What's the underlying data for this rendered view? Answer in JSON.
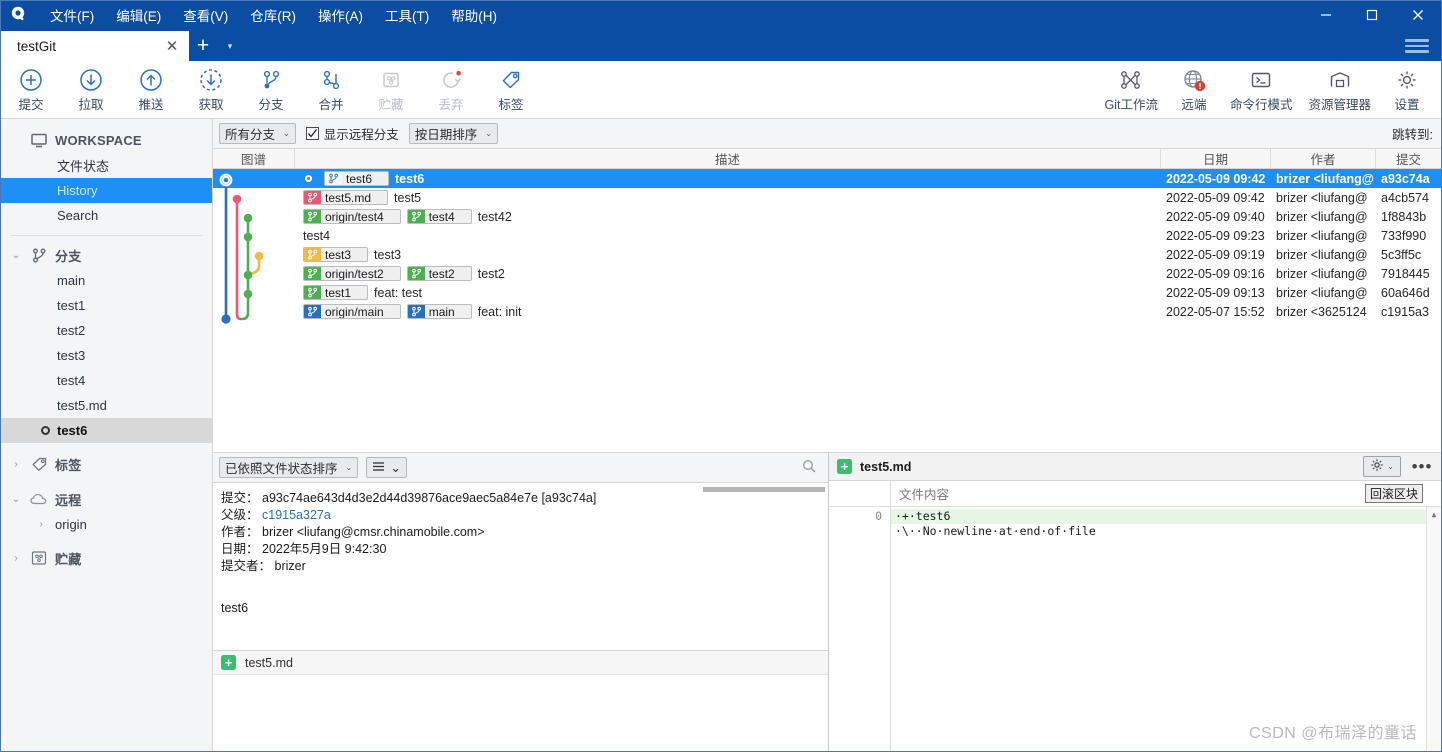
{
  "window": {
    "app_icon": "sourcetree-logo-icon",
    "minimize": "−",
    "maximize": "□",
    "close": "✕",
    "menu": [
      {
        "label": "文件(F)",
        "name": "menu-file"
      },
      {
        "label": "编辑(E)",
        "name": "menu-edit"
      },
      {
        "label": "查看(V)",
        "name": "menu-view"
      },
      {
        "label": "仓库(R)",
        "name": "menu-repository"
      },
      {
        "label": "操作(A)",
        "name": "menu-actions"
      },
      {
        "label": "工具(T)",
        "name": "menu-tools"
      },
      {
        "label": "帮助(H)",
        "name": "menu-help"
      }
    ]
  },
  "tabs": {
    "active": "testGit",
    "close_label": "✕",
    "add_label": "+",
    "caret_label": "▾"
  },
  "toolbar": {
    "left": [
      {
        "label": "提交",
        "icon": "commit-plus-icon",
        "disabled": false
      },
      {
        "label": "拉取",
        "icon": "pull-down-arrow-icon",
        "disabled": false
      },
      {
        "label": "推送",
        "icon": "push-up-arrow-icon",
        "disabled": false
      },
      {
        "label": "获取",
        "icon": "fetch-dashed-down-icon",
        "disabled": false
      },
      {
        "label": "分支",
        "icon": "branch-icon",
        "disabled": false
      },
      {
        "label": "合并",
        "icon": "merge-icon",
        "disabled": false
      },
      {
        "label": "贮藏",
        "icon": "stash-icon",
        "disabled": true
      },
      {
        "label": "丢弃",
        "icon": "discard-refresh-icon",
        "disabled": true
      },
      {
        "label": "标签",
        "icon": "tag-icon",
        "disabled": false
      }
    ],
    "right": [
      {
        "label": "Git工作流",
        "icon": "gitflow-icon",
        "disabled": false
      },
      {
        "label": "远端",
        "icon": "remote-globe-icon",
        "badge": "!",
        "disabled": false
      },
      {
        "label": "命令行模式",
        "icon": "terminal-icon",
        "disabled": false
      },
      {
        "label": "资源管理器",
        "icon": "explorer-folder-icon",
        "disabled": false
      },
      {
        "label": "设置",
        "icon": "gear-icon",
        "disabled": false
      }
    ]
  },
  "sidebar": {
    "workspace": {
      "label": "WORKSPACE",
      "icon": "monitor-icon"
    },
    "workspace_items": [
      {
        "label": "文件状态",
        "selected": false
      },
      {
        "label": "History",
        "selected": true
      },
      {
        "label": "Search",
        "selected": false
      }
    ],
    "branches": {
      "label": "分支",
      "icon": "branch-icon",
      "expanded": true
    },
    "branch_items": [
      {
        "label": "main",
        "current": false
      },
      {
        "label": "test1",
        "current": false
      },
      {
        "label": "test2",
        "current": false
      },
      {
        "label": "test3",
        "current": false
      },
      {
        "label": "test4",
        "current": false
      },
      {
        "label": "test5.md",
        "current": false
      },
      {
        "label": "test6",
        "current": true
      }
    ],
    "tags": {
      "label": "标签",
      "icon": "tag-icon",
      "expanded": false
    },
    "remotes": {
      "label": "远程",
      "icon": "cloud-icon",
      "expanded": true
    },
    "remote_items": [
      {
        "label": "origin"
      }
    ],
    "stashes": {
      "label": "贮藏",
      "icon": "stash-icon",
      "expanded": false
    }
  },
  "filterbar": {
    "branch_filter": "所有分支",
    "show_remote_branches": "显示远程分支",
    "show_remote_checked": true,
    "sort_order": "按日期排序",
    "jump_to": "跳转到:"
  },
  "commit_table": {
    "columns": [
      "图谱",
      "描述",
      "日期",
      "作者",
      "提交"
    ],
    "rows": [
      {
        "selected": true,
        "head": true,
        "refs": [
          {
            "name": "test6",
            "color": "white"
          }
        ],
        "desc": "test6",
        "date": "2022-05-09 09:42",
        "author": "brizer <liufang@",
        "hash": "a93c74a"
      },
      {
        "selected": false,
        "head": false,
        "refs": [
          {
            "name": "test5.md",
            "color": "pink"
          }
        ],
        "desc": "test5",
        "date": "2022-05-09 09:42",
        "author": "brizer <liufang@",
        "hash": "a4cb574"
      },
      {
        "selected": false,
        "head": false,
        "refs": [
          {
            "name": "origin/test4",
            "color": "green"
          },
          {
            "name": "test4",
            "color": "green"
          }
        ],
        "desc": "test42",
        "date": "2022-05-09 09:40",
        "author": "brizer <liufang@",
        "hash": "1f8843b"
      },
      {
        "selected": false,
        "head": false,
        "refs": [],
        "desc": "test4",
        "date": "2022-05-09 09:23",
        "author": "brizer <liufang@",
        "hash": "733f990"
      },
      {
        "selected": false,
        "head": false,
        "refs": [
          {
            "name": "test3",
            "color": "amber"
          }
        ],
        "desc": "test3",
        "date": "2022-05-09 09:19",
        "author": "brizer <liufang@",
        "hash": "5c3ff5c"
      },
      {
        "selected": false,
        "head": false,
        "refs": [
          {
            "name": "origin/test2",
            "color": "green"
          },
          {
            "name": "test2",
            "color": "green"
          }
        ],
        "desc": "test2",
        "date": "2022-05-09 09:16",
        "author": "brizer <liufang@",
        "hash": "7918445"
      },
      {
        "selected": false,
        "head": false,
        "refs": [
          {
            "name": "test1",
            "color": "green"
          }
        ],
        "desc": "feat: test",
        "date": "2022-05-09 09:13",
        "author": "brizer <liufang@",
        "hash": "60a646d"
      },
      {
        "selected": false,
        "head": false,
        "refs": [
          {
            "name": "origin/main",
            "color": "blue"
          },
          {
            "name": "main",
            "color": "blue"
          }
        ],
        "desc": "feat: init",
        "date": "2022-05-07 15:52",
        "author": "brizer <3625124",
        "hash": "c1915a3"
      }
    ]
  },
  "detail_panel": {
    "sort_combo": "已依照文件状态排序",
    "list_view_icon": "list-view-icon",
    "search_icon": "search-icon",
    "commit_label": "提交：",
    "commit_value": "a93c74ae643d4d3e2d44d39876ace9aec5a84e7e [a93c74a]",
    "parent_label": "父级：",
    "parent_value": "c1915a327a",
    "author_label": "作者：",
    "author_value": "brizer <liufang@cmsr.chinamobile.com>",
    "date_label": "日期：",
    "date_value": "2022年5月9日 9:42:30",
    "committer_label": "提交者：",
    "committer_value": "brizer",
    "message": "test6",
    "file_row": {
      "badge": "+",
      "name": "test5.md"
    }
  },
  "diff_panel": {
    "badge": "+",
    "filename": "test5.md",
    "gear_icon": "gear-icon",
    "more_icon": "more-dots-icon",
    "content_header": "文件内容",
    "rollback_button": "回滚区块",
    "lines": [
      {
        "gutter": "0",
        "text": "·+·test6",
        "type": "add"
      },
      {
        "gutter": "",
        "text": "·\\··No·newline·at·end·of·file",
        "type": "meta"
      }
    ]
  },
  "watermark": "CSDN @布瑞泽的童话",
  "colors": {
    "title_blue": "#0b4da2",
    "selection_blue": "#1e8ff5",
    "green_ref": "#4caf50",
    "pink_ref": "#ef5673",
    "amber_ref": "#f5b942",
    "blue_ref": "#2a6fbb",
    "add_green_bg": "#e6f7e6"
  }
}
